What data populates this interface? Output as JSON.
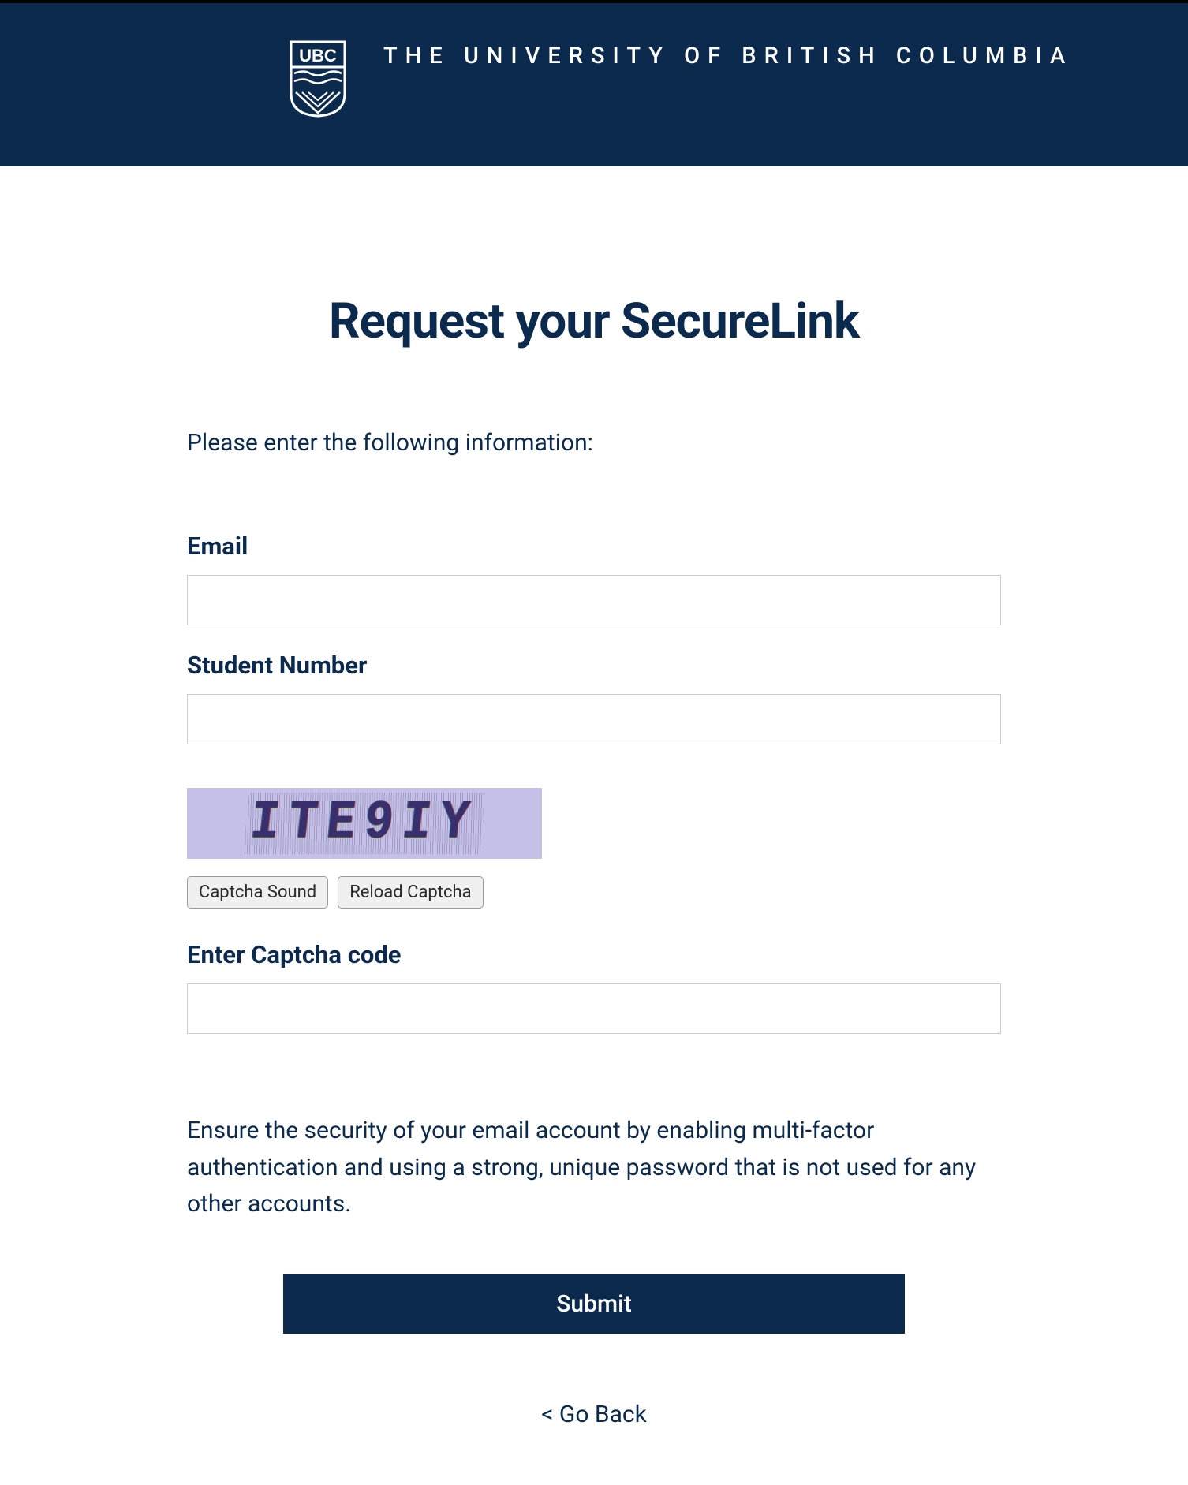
{
  "header": {
    "university_name": "THE UNIVERSITY OF BRITISH COLUMBIA",
    "logo_text": "UBC"
  },
  "page": {
    "title": "Request your SecureLink",
    "intro": "Please enter the following information:"
  },
  "form": {
    "email_label": "Email",
    "email_value": "",
    "student_number_label": "Student Number",
    "student_number_value": "",
    "captcha_sound_label": "Captcha Sound",
    "reload_captcha_label": "Reload Captcha",
    "captcha_label": "Enter Captcha code",
    "captcha_value": "",
    "captcha_image_text": "ITE9IY",
    "security_note": "Ensure the security of your email account by enabling multi-factor authentication and using a strong, unique password that is not used for any other accounts.",
    "submit_label": "Submit",
    "go_back_label": "< Go Back"
  }
}
